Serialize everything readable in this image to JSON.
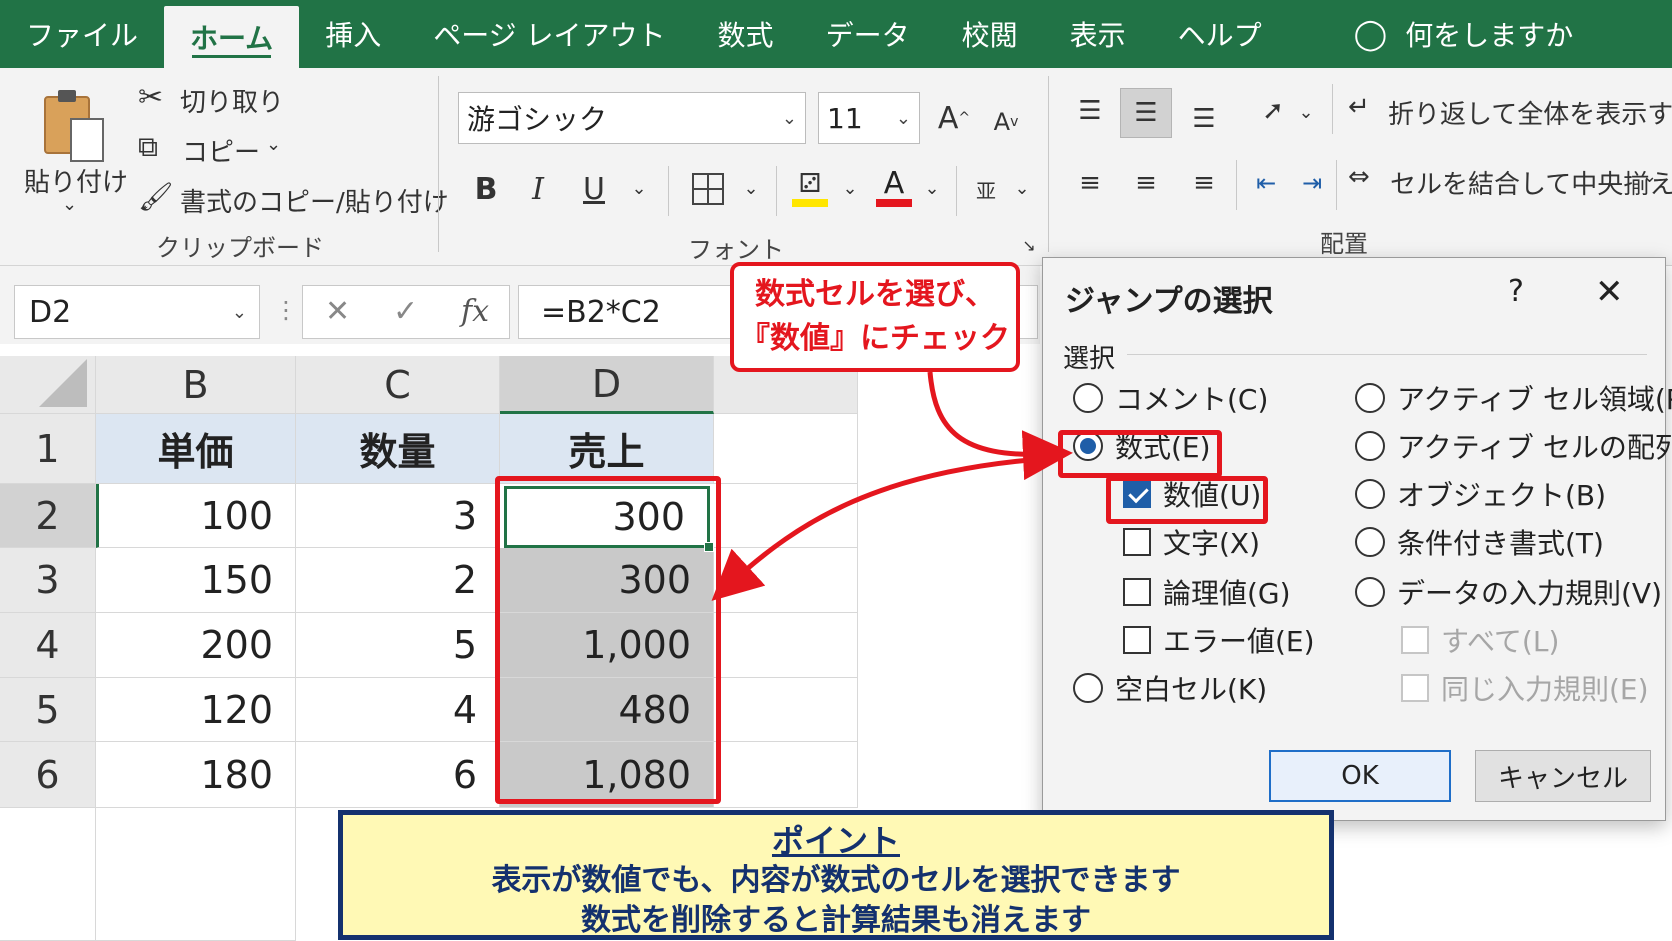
{
  "tabs": [
    "ファイル",
    "ホーム",
    "挿入",
    "ページ レイアウト",
    "数式",
    "データ",
    "校閲",
    "表示",
    "ヘルプ"
  ],
  "active_tab": "ホーム",
  "tell_me": "何をしますか",
  "clipboard": {
    "paste": "貼り付け",
    "cut": "切り取り",
    "copy": "コピー",
    "format_painter": "書式のコピー/貼り付け",
    "group_label": "クリップボード"
  },
  "font": {
    "name": "游ゴシック",
    "size": "11",
    "bold": "B",
    "italic": "I",
    "underline": "U",
    "group_label": "フォント"
  },
  "alignment": {
    "wrap_text": "折り返して全体を表示する",
    "merge_center": "セルを結合して中央揃え",
    "group_label": "配置"
  },
  "formula_bar": {
    "name_box": "D2",
    "formula": "=B2*C2"
  },
  "sheet": {
    "columns": [
      "B",
      "C",
      "D"
    ],
    "row_numbers": [
      "1",
      "2",
      "3",
      "4",
      "5",
      "6"
    ],
    "headers": [
      "単価",
      "数量",
      "売上"
    ],
    "rows": [
      [
        "100",
        "3",
        "300"
      ],
      [
        "150",
        "2",
        "300"
      ],
      [
        "200",
        "5",
        "1,000"
      ],
      [
        "120",
        "4",
        "480"
      ],
      [
        "180",
        "6",
        "1,080"
      ]
    ]
  },
  "callout": {
    "line1": "数式セルを選び、",
    "line2": "『数値』にチェック"
  },
  "dialog": {
    "title": "ジャンプの選択",
    "help": "?",
    "section": "選択",
    "options": {
      "comment": "コメント(C)",
      "formula": "数式(E)",
      "numbers": "数値(U)",
      "text": "文字(X)",
      "logical": "論理値(G)",
      "errors": "エラー値(E)",
      "blanks": "空白セル(K)",
      "current_region": "アクティブ セル領域(R)",
      "current_array": "アクティブ セルの配列(A)",
      "objects": "オブジェクト(B)",
      "conditional_formats": "条件付き書式(T)",
      "data_validation": "データの入力規則(V)",
      "all": "すべて(L)",
      "same": "同じ入力規則(E)"
    },
    "ok": "OK",
    "cancel": "キャンセル"
  },
  "point": {
    "title": "ポイント",
    "line1": "表示が数値でも、内容が数式のセルを選択できます",
    "line2": "数式を削除すると計算結果も消えます"
  },
  "colors": {
    "excel_green": "#217346",
    "annotation_red": "#e4161e",
    "point_navy": "#14316e",
    "point_bg": "#fff9b5"
  }
}
